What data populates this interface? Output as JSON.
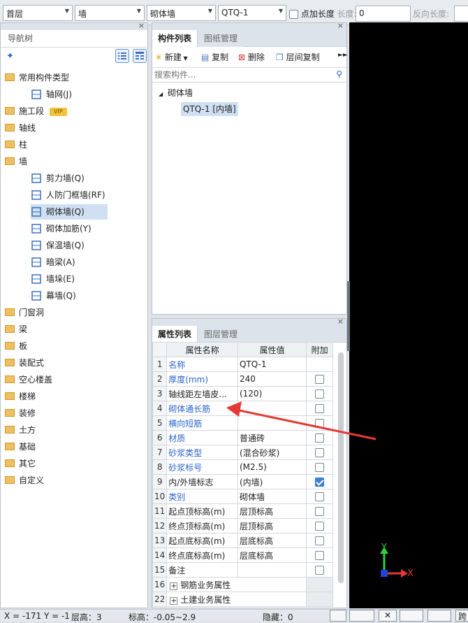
{
  "toolbar": {
    "floor": "首层",
    "category": "墙",
    "type": "砌体墙",
    "component": "QTQ-1",
    "add_length_label": "点加长度",
    "length_label": "长度:",
    "length_value": "0",
    "reverse_length_label": "反向长度:"
  },
  "nav": {
    "title": "导航树",
    "items": [
      {
        "label": "常用构件类型",
        "level": 0,
        "expanded": true
      },
      {
        "label": "轴网(J)",
        "level": 1
      },
      {
        "label": "施工段",
        "level": 0,
        "badge": "VIP"
      },
      {
        "label": "轴线",
        "level": 0
      },
      {
        "label": "柱",
        "level": 0
      },
      {
        "label": "墙",
        "level": 0,
        "expanded": true
      },
      {
        "label": "剪力墙(Q)",
        "level": 1
      },
      {
        "label": "人防门框墙(RF)",
        "level": 1
      },
      {
        "label": "砌体墙(Q)",
        "level": 1,
        "selected": true
      },
      {
        "label": "砌体加筋(Y)",
        "level": 1
      },
      {
        "label": "保温墙(Q)",
        "level": 1
      },
      {
        "label": "暗梁(A)",
        "level": 1
      },
      {
        "label": "墙垛(E)",
        "level": 1
      },
      {
        "label": "幕墙(Q)",
        "level": 1
      },
      {
        "label": "门窗洞",
        "level": 0
      },
      {
        "label": "梁",
        "level": 0
      },
      {
        "label": "板",
        "level": 0
      },
      {
        "label": "装配式",
        "level": 0
      },
      {
        "label": "空心楼盖",
        "level": 0
      },
      {
        "label": "楼梯",
        "level": 0
      },
      {
        "label": "装修",
        "level": 0
      },
      {
        "label": "土方",
        "level": 0
      },
      {
        "label": "基础",
        "level": 0
      },
      {
        "label": "其它",
        "level": 0
      },
      {
        "label": "自定义",
        "level": 0
      }
    ]
  },
  "component_panel": {
    "tabs": [
      "构件列表",
      "图纸管理"
    ],
    "buttons": {
      "new": "新建",
      "copy": "复制",
      "delete": "删除",
      "floor_copy": "层间复制"
    },
    "search_placeholder": "搜索构件...",
    "tree_root": "砌体墙",
    "tree_child": "QTQ-1 [内墙]"
  },
  "props_panel": {
    "tabs": [
      "属性列表",
      "图层管理"
    ],
    "headers": [
      "属性名称",
      "属性值",
      "附加"
    ],
    "rows": [
      {
        "n": "1",
        "name": "名称",
        "value": "QTQ-1",
        "blue": true,
        "check": "none"
      },
      {
        "n": "2",
        "name": "厚度(mm)",
        "value": "240",
        "blue": true,
        "check": "off"
      },
      {
        "n": "3",
        "name": "轴线距左墙皮...",
        "value": "(120)",
        "blue": false,
        "check": "off"
      },
      {
        "n": "4",
        "name": "砌体通长筋",
        "value": "",
        "blue": true,
        "check": "off"
      },
      {
        "n": "5",
        "name": "横向短筋",
        "value": "",
        "blue": true,
        "check": "off"
      },
      {
        "n": "6",
        "name": "材质",
        "value": "普通砖",
        "blue": true,
        "check": "off"
      },
      {
        "n": "7",
        "name": "砂浆类型",
        "value": "(混合砂浆)",
        "blue": true,
        "check": "off"
      },
      {
        "n": "8",
        "name": "砂浆标号",
        "value": "(M2.5)",
        "blue": true,
        "check": "off"
      },
      {
        "n": "9",
        "name": "内/外墙标志",
        "value": "(内墙)",
        "blue": false,
        "check": "on"
      },
      {
        "n": "10",
        "name": "类别",
        "value": "砌体墙",
        "blue": true,
        "check": "off"
      },
      {
        "n": "11",
        "name": "起点顶标高(m)",
        "value": "层顶标高",
        "blue": false,
        "check": "off"
      },
      {
        "n": "12",
        "name": "终点顶标高(m)",
        "value": "层顶标高",
        "blue": false,
        "check": "off"
      },
      {
        "n": "13",
        "name": "起点底标高(m)",
        "value": "层底标高",
        "blue": false,
        "check": "off"
      },
      {
        "n": "14",
        "name": "终点底标高(m)",
        "value": "层底标高",
        "blue": false,
        "check": "off"
      },
      {
        "n": "15",
        "name": "备注",
        "value": "",
        "blue": false,
        "check": "off"
      },
      {
        "n": "16",
        "name": "钢筋业务属性",
        "value": "",
        "blue": false,
        "check": "group"
      },
      {
        "n": "22",
        "name": "土建业务属性",
        "value": "",
        "blue": false,
        "check": "group"
      }
    ]
  },
  "axes": {
    "y": "Y",
    "x": "X"
  },
  "status": {
    "coords": "X = -171 Y = -1",
    "floor_height": "层高：3",
    "elevation": "标高：-0.05~2.9",
    "hidden": "隐藏：0",
    "tail": "跨"
  },
  "colors": {
    "accent": "#2a64c9",
    "canvas": "#000000",
    "arrow": "#e53935"
  }
}
